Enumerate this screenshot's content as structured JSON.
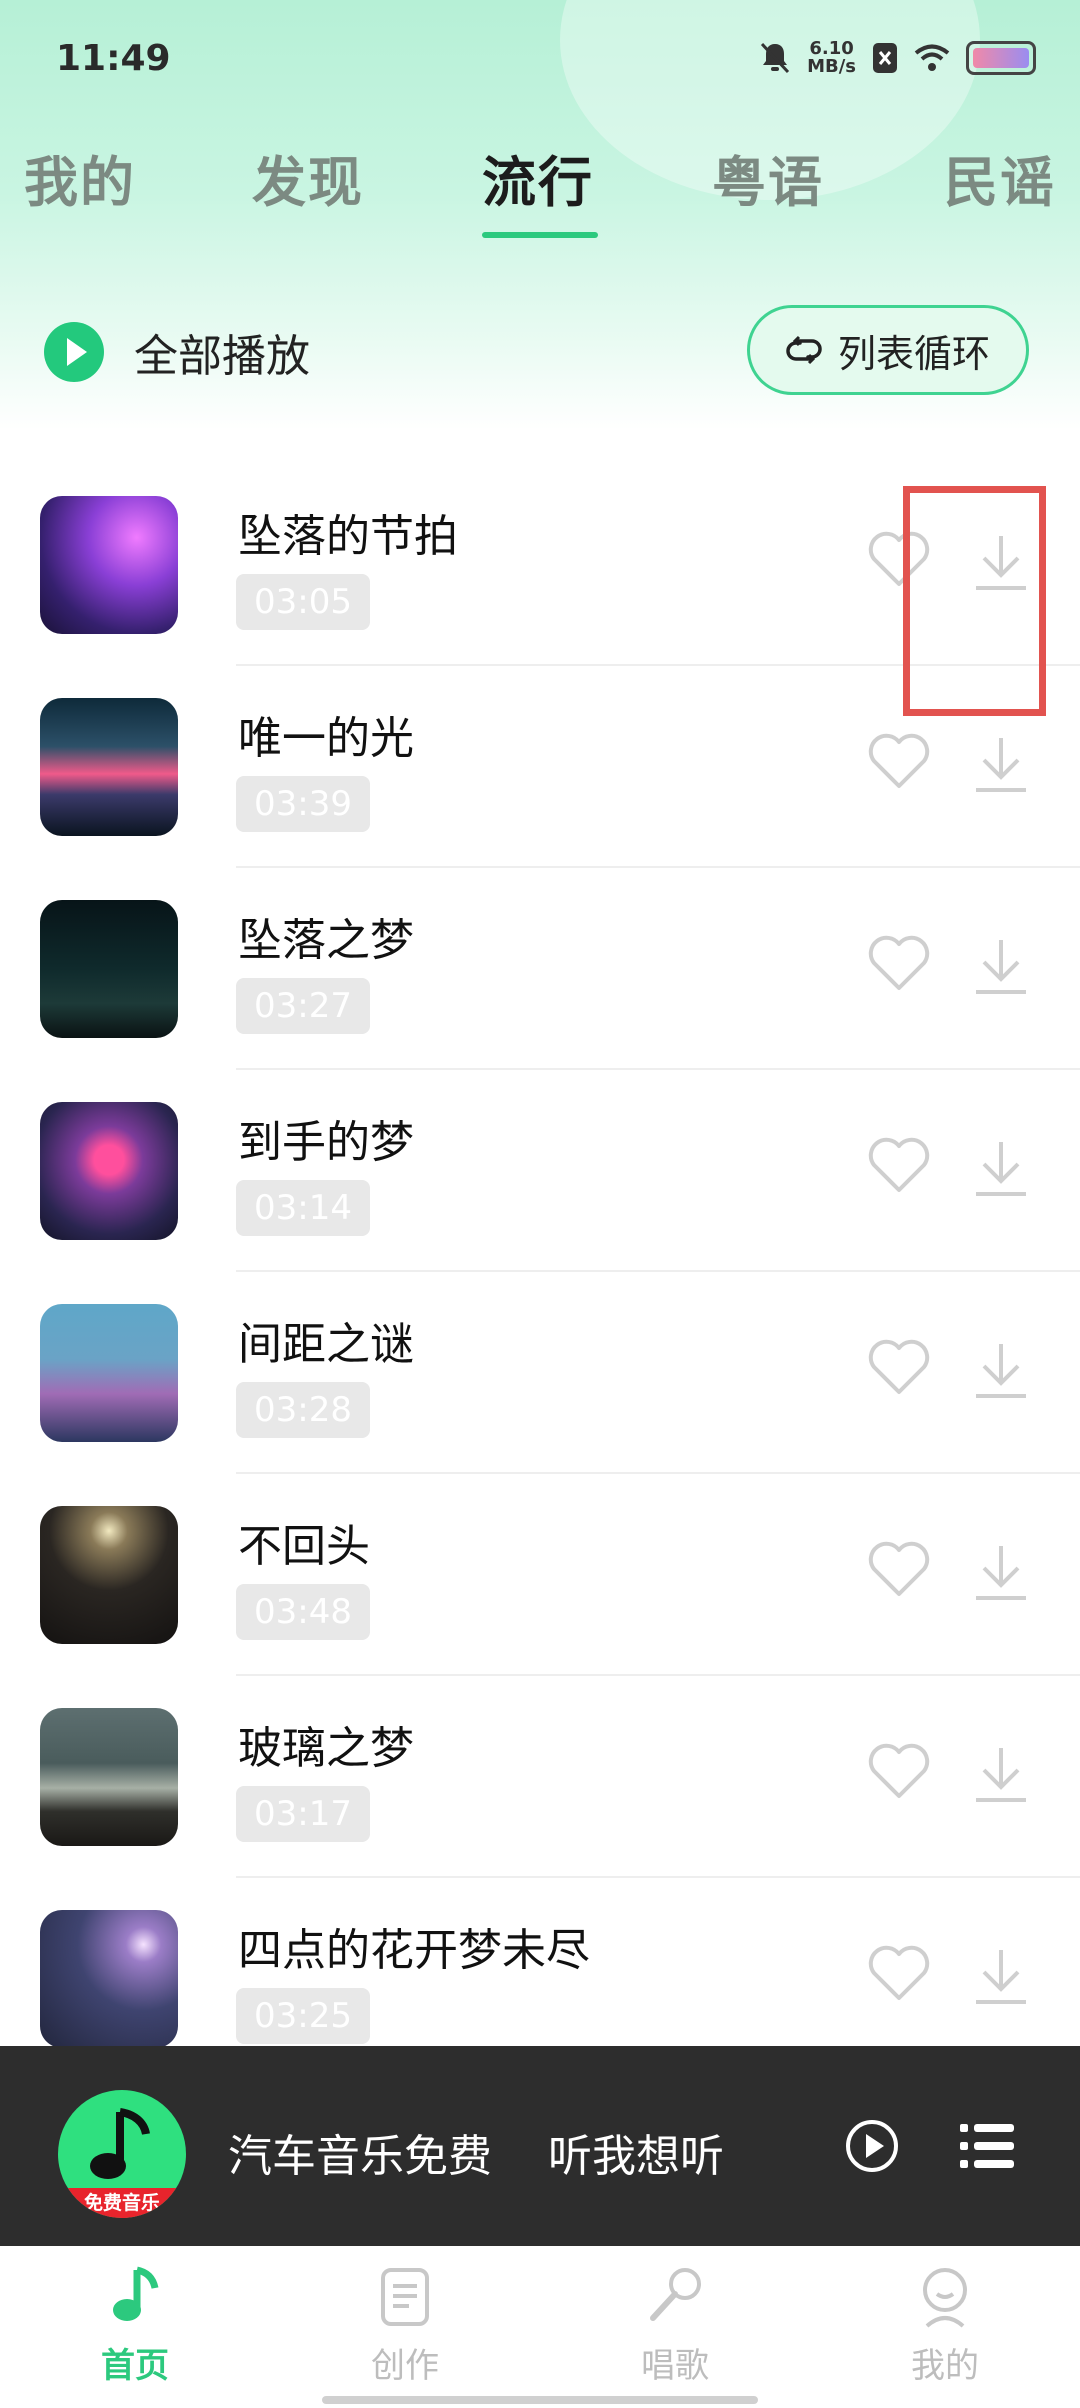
{
  "status_bar": {
    "time": "11:49",
    "net_speed": "6.10",
    "net_unit": "MB/s"
  },
  "tabs": [
    {
      "label": "我的"
    },
    {
      "label": "发现"
    },
    {
      "label": "流行"
    },
    {
      "label": "粤语"
    },
    {
      "label": "民谣"
    }
  ],
  "active_tab": "流行",
  "toolbar": {
    "play_all": "全部播放",
    "loop_mode": "列表循环"
  },
  "songs": [
    {
      "title": "坠落的节拍",
      "duration": "03:05"
    },
    {
      "title": "唯一的光",
      "duration": "03:39"
    },
    {
      "title": "坠落之梦",
      "duration": "03:27"
    },
    {
      "title": "到手的梦",
      "duration": "03:14"
    },
    {
      "title": "间距之谜",
      "duration": "03:28"
    },
    {
      "title": "不回头",
      "duration": "03:48"
    },
    {
      "title": "玻璃之梦",
      "duration": "03:17"
    },
    {
      "title": "四点的花开梦未尽",
      "duration": "03:25"
    }
  ],
  "mini_player": {
    "cover_badge": "免费音乐",
    "title": "汽车音乐免费    听我想听"
  },
  "bottom_nav": [
    {
      "label": "首页",
      "icon": "music-note-icon"
    },
    {
      "label": "创作",
      "icon": "document-icon"
    },
    {
      "label": "唱歌",
      "icon": "microphone-icon"
    },
    {
      "label": "我的",
      "icon": "profile-icon"
    }
  ],
  "colors": {
    "accent": "#2cc97e",
    "highlight": "#e2534f",
    "player_bg": "#2d2d2d"
  }
}
